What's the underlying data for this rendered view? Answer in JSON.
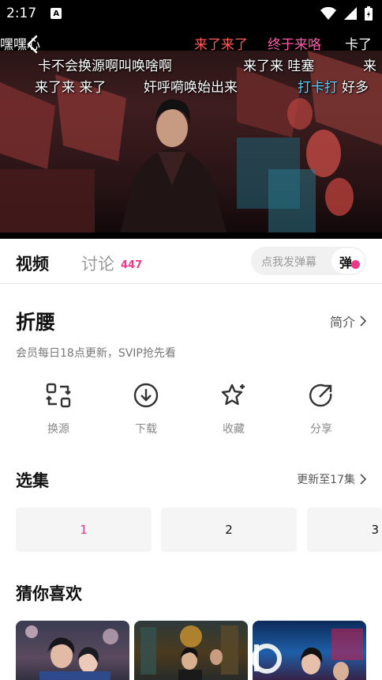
{
  "status_bar": {
    "time": "2:17",
    "notification_letter": "A"
  },
  "danmaku": [
    {
      "text": "嘿嘿心",
      "color": "#ffffff"
    },
    {
      "text": "来了来了",
      "color": "#ff5a5a"
    },
    {
      "text": "终于来咯",
      "color": "#ff5aa8"
    },
    {
      "text": "卡了",
      "color": "#ffffff"
    },
    {
      "text": "卡不会换源啊叫唤啥啊",
      "color": "#ffffff"
    },
    {
      "text": "来了来 哇塞",
      "color": "#ffffff"
    },
    {
      "text": "来",
      "color": "#ffffff"
    },
    {
      "text": "来了来 来了",
      "color": "#ffffff"
    },
    {
      "text": "奸呼嗬唤始出来",
      "color": "#ffffff"
    },
    {
      "text": "打卡打",
      "color": "#5ad0ff"
    },
    {
      "text": "好多",
      "color": "#ffffff"
    }
  ],
  "tabs": {
    "video": "视频",
    "discuss": "讨论",
    "discuss_count": "447"
  },
  "danmu_input": {
    "placeholder": "点我发弹幕",
    "toggle_label": "弹"
  },
  "show": {
    "title": "折腰",
    "intro_label": "简介",
    "subtitle": "会员每日18点更新，SVIP抢先看"
  },
  "actions": [
    {
      "label": "换源",
      "icon": "switch-source-icon"
    },
    {
      "label": "下载",
      "icon": "download-icon"
    },
    {
      "label": "收藏",
      "icon": "star-icon"
    },
    {
      "label": "分享",
      "icon": "share-icon"
    }
  ],
  "episodes": {
    "title": "选集",
    "more_label": "更新至17集",
    "items": [
      "1",
      "2",
      "3"
    ],
    "selected": "1"
  },
  "recommend": {
    "title": "猜你喜欢"
  },
  "colors": {
    "accent": "#f0388a",
    "text_primary": "#111111",
    "text_secondary": "#888888"
  }
}
